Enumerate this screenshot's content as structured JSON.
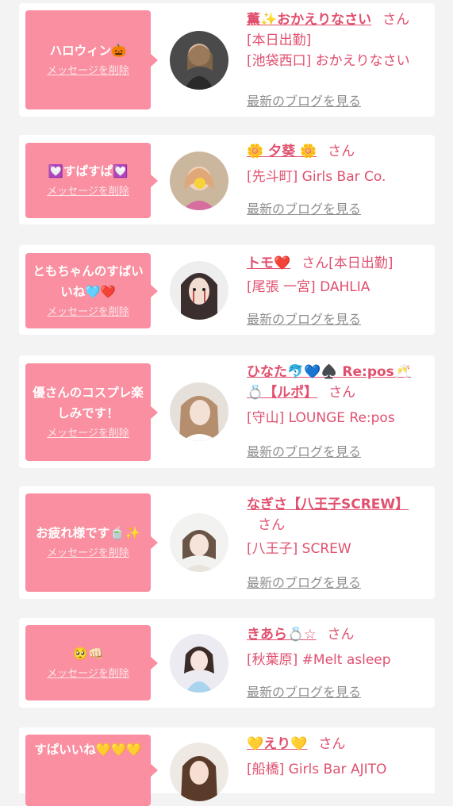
{
  "san_label": "さん",
  "blog_label": "最新のブログを見る",
  "delete_label": "メッセージを削除",
  "cards": [
    {
      "message": "ハロウィン🎃",
      "name": "薫✨おかえりなさい",
      "san": "さん",
      "status": "[本日出勤]",
      "shop": "[池袋西口] おかえりなさい"
    },
    {
      "message": "💟すぱすぱ💟",
      "name": "🌼 夕葵 🌼",
      "san": "さん",
      "status": "",
      "shop": "[先斗町] Girls Bar Co."
    },
    {
      "message": "ともちゃんのすばいいね🩵❤️",
      "name": "トモ❤️",
      "san": "さん",
      "status": "[本日出勤]",
      "shop": "[尾張 一宮] DAHLIA"
    },
    {
      "message": "優さんのコスプレ楽しみです！",
      "name": "ひなた🐬💙♠️ Re:pos🥂💍【ルポ】",
      "san": "さん",
      "status": "",
      "shop": "[守山] LOUNGE Re:pos"
    },
    {
      "message": "お疲れ様です🍵✨",
      "name": "なぎさ【八王子SCREW】",
      "san": "さん",
      "status": "",
      "shop": "[八王子] SCREW"
    },
    {
      "message": "🥺👊🏻",
      "name": "きあら💍☆",
      "san": "さん",
      "status": "",
      "shop": "[秋葉原] #Melt asleep"
    },
    {
      "message": "すぱいいね💛💛💛",
      "name": "💛えり💛",
      "san": "さん",
      "status": "",
      "shop": "[船橋] Girls Bar AJITO"
    }
  ]
}
